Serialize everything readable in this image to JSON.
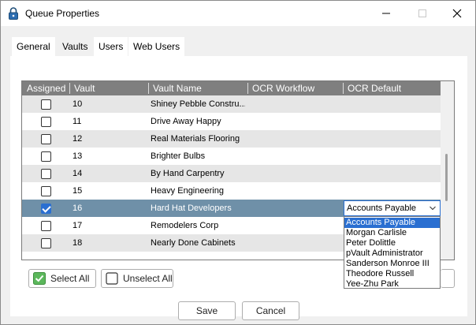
{
  "window": {
    "title": "Queue Properties"
  },
  "tabs": [
    {
      "label": "General",
      "active": false
    },
    {
      "label": "Vaults",
      "active": true
    },
    {
      "label": "Users",
      "active": false
    },
    {
      "label": "Web Users",
      "active": false
    }
  ],
  "grid": {
    "columns": [
      "Assigned",
      "Vault",
      "Vault Name",
      "OCR Workflow",
      "OCR Default Processor"
    ],
    "rows": [
      {
        "assigned": false,
        "vault": "10",
        "name": "Shiney Pebble Constru...",
        "workflow": "",
        "processor": ""
      },
      {
        "assigned": false,
        "vault": "11",
        "name": "Drive Away Happy",
        "workflow": "",
        "processor": ""
      },
      {
        "assigned": false,
        "vault": "12",
        "name": "Real Materials Flooring",
        "workflow": "",
        "processor": ""
      },
      {
        "assigned": false,
        "vault": "13",
        "name": "Brighter Bulbs",
        "workflow": "",
        "processor": ""
      },
      {
        "assigned": false,
        "vault": "14",
        "name": "By Hand Carpentry",
        "workflow": "",
        "processor": ""
      },
      {
        "assigned": false,
        "vault": "15",
        "name": "Heavy Engineering",
        "workflow": "",
        "processor": ""
      },
      {
        "assigned": true,
        "vault": "16",
        "name": "Hard Hat Developers",
        "workflow": "",
        "processor": "Accounts Payable"
      },
      {
        "assigned": false,
        "vault": "17",
        "name": "Remodelers Corp",
        "workflow": "",
        "processor": ""
      },
      {
        "assigned": false,
        "vault": "18",
        "name": "Nearly Done Cabinets",
        "workflow": "",
        "processor": ""
      }
    ]
  },
  "processor_dropdown": {
    "value": "Accounts Payable",
    "options": [
      "Accounts Payable",
      "Morgan Carlisle",
      "Peter Dolittle",
      "pVault Administrator",
      "Sanderson Monroe III",
      "Theodore Russell",
      "Yee-Zhu Park"
    ],
    "highlighted": "Accounts Payable"
  },
  "buttons": {
    "select_all": "Select All",
    "unselect_all": "Unselect All",
    "save": "Save",
    "cancel": "Cancel"
  },
  "colors": {
    "header_bg": "#7f7f7f",
    "selected_row": "#6f90a8",
    "accent": "#2a6fd1",
    "select_all_icon": "#5cb85c"
  },
  "icons": {
    "app": "padlock-icon",
    "minimize": "minimize-icon",
    "maximize": "maximize-icon",
    "close": "close-icon",
    "select_all": "checkbox-checked-icon",
    "unselect_all": "checkbox-empty-icon",
    "dropdown": "chevron-down-icon"
  }
}
